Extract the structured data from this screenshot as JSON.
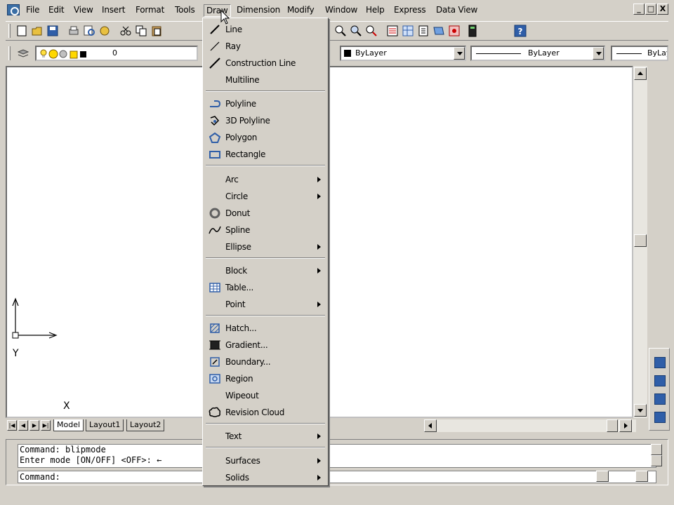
{
  "menubar": {
    "items": [
      "File",
      "Edit",
      "View",
      "Insert",
      "Format",
      "Tools",
      "Draw",
      "Dimension",
      "Modify",
      "Window",
      "Help",
      "Express",
      "Data View"
    ],
    "active": "Draw"
  },
  "window_buttons": [
    "_",
    "□",
    "X"
  ],
  "layers": {
    "current_layer": "0",
    "color": "ByLayer",
    "linetype": "ByLayer",
    "lineweight": "ByLay"
  },
  "draw_menu": {
    "items": [
      {
        "label": "Line",
        "icon": "line-icon"
      },
      {
        "label": "Ray",
        "icon": "ray-icon"
      },
      {
        "label": "Construction Line",
        "icon": "construction-line-icon"
      },
      {
        "label": "Multiline",
        "icon": ""
      },
      {
        "label": "Polyline",
        "icon": "polyline-icon"
      },
      {
        "label": "3D Polyline",
        "icon": "3d-polyline-icon"
      },
      {
        "label": "Polygon",
        "icon": "polygon-icon"
      },
      {
        "label": "Rectangle",
        "icon": "rectangle-icon"
      },
      {
        "label": "Arc",
        "icon": "",
        "submenu": true
      },
      {
        "label": "Circle",
        "icon": "",
        "submenu": true
      },
      {
        "label": "Donut",
        "icon": "donut-icon"
      },
      {
        "label": "Spline",
        "icon": "spline-icon"
      },
      {
        "label": "Ellipse",
        "icon": "",
        "submenu": true
      },
      {
        "label": "Block",
        "icon": "",
        "submenu": true
      },
      {
        "label": "Table...",
        "icon": "table-icon"
      },
      {
        "label": "Point",
        "icon": "",
        "submenu": true
      },
      {
        "label": "Hatch...",
        "icon": "hatch-icon"
      },
      {
        "label": "Gradient...",
        "icon": "gradient-icon"
      },
      {
        "label": "Boundary...",
        "icon": "boundary-icon"
      },
      {
        "label": "Region",
        "icon": "region-icon"
      },
      {
        "label": "Wipeout",
        "icon": ""
      },
      {
        "label": "Revision Cloud",
        "icon": "revision-cloud-icon"
      },
      {
        "label": "Text",
        "icon": "",
        "submenu": true
      },
      {
        "label": "Surfaces",
        "icon": "",
        "submenu": true
      },
      {
        "label": "Solids",
        "icon": "",
        "submenu": true
      }
    ]
  },
  "tabs": [
    "Model",
    "Layout1",
    "Layout2"
  ],
  "active_tab": "Model",
  "command": {
    "history": [
      "Command: blipmode",
      "Enter mode [ON/OFF] <OFF>: ←"
    ],
    "prompt": "Command:"
  },
  "ucs": {
    "x_label": "X",
    "y_label": "Y"
  }
}
